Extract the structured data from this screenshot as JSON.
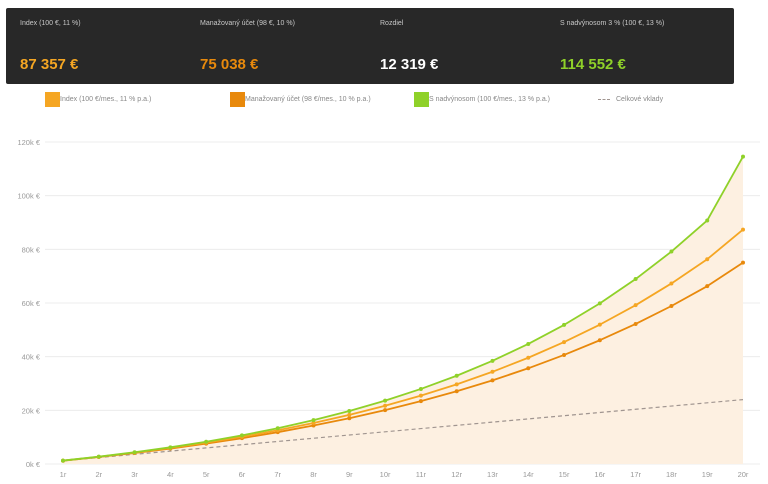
{
  "summary": {
    "index": {
      "label": "Index (100 €, 11 %)",
      "value": "87 357 €",
      "color": "#f5a623"
    },
    "managed": {
      "label": "Manažovaný účet (98 €, 10 %)",
      "value": "75 038 €",
      "color": "#e8890c"
    },
    "difference": {
      "label": "Rozdiel",
      "value": "12 319 €",
      "color": "#ffffff"
    },
    "bonus": {
      "label": "S nadvýnosom 3 % (100 €, 13 %)",
      "value": "114 552 €",
      "color": "#8fd129"
    }
  },
  "legend": {
    "index": "Index (100 €/mes., 11 % p.a.)",
    "managed": "Manažovaný účet (98 €/mes., 10 % p.a.)",
    "bonus": "S nadvýnosom (100 €/mes., 13 % p.a.)",
    "deposits": "Celkové vklady"
  },
  "chart_data": {
    "type": "line",
    "categories": [
      "1r",
      "2r",
      "3r",
      "4r",
      "5r",
      "6r",
      "7r",
      "8r",
      "9r",
      "10r",
      "11r",
      "12r",
      "13r",
      "14r",
      "15r",
      "16r",
      "17r",
      "18r",
      "19r",
      "20r"
    ],
    "ylim": [
      0,
      120000
    ],
    "yticks": [
      "0k €",
      "20k €",
      "40k €",
      "60k €",
      "80k €",
      "100k €",
      "120k €"
    ],
    "grid": true,
    "series": [
      {
        "name": "Index (100 €/mes., 11 % p.a.)",
        "color": "#f5a623",
        "values": [
          1266,
          2677,
          4250,
          6005,
          7963,
          10147,
          12582,
          15298,
          18327,
          21706,
          25475,
          29678,
          34366,
          39596,
          45428,
          51934,
          59190,
          67284,
          76311,
          87357
        ]
      },
      {
        "name": "Manažovaný účet (98 €/mes., 10 % p.a.)",
        "color": "#e8890c",
        "values": [
          1232,
          2593,
          4097,
          5758,
          7593,
          9620,
          11859,
          14333,
          17066,
          20085,
          23420,
          27104,
          31174,
          35670,
          40637,
          46124,
          52186,
          58882,
          66279,
          75038
        ]
      },
      {
        "name": "S nadvýnosom (100 €/mes., 13 % p.a.)",
        "color": "#8fd129",
        "values": [
          1281,
          2729,
          4366,
          6216,
          8306,
          10669,
          13339,
          16355,
          19765,
          23618,
          27972,
          32893,
          38453,
          44737,
          51838,
          59861,
          68929,
          79175,
          90752,
          114552
        ]
      },
      {
        "name": "Celkové vklady",
        "color": "#a09590",
        "dashed": true,
        "values": [
          1200,
          2400,
          3600,
          4800,
          6000,
          7200,
          8400,
          9600,
          10800,
          12000,
          13200,
          14400,
          15600,
          16800,
          18000,
          19200,
          20400,
          21600,
          22800,
          24000
        ]
      }
    ]
  }
}
